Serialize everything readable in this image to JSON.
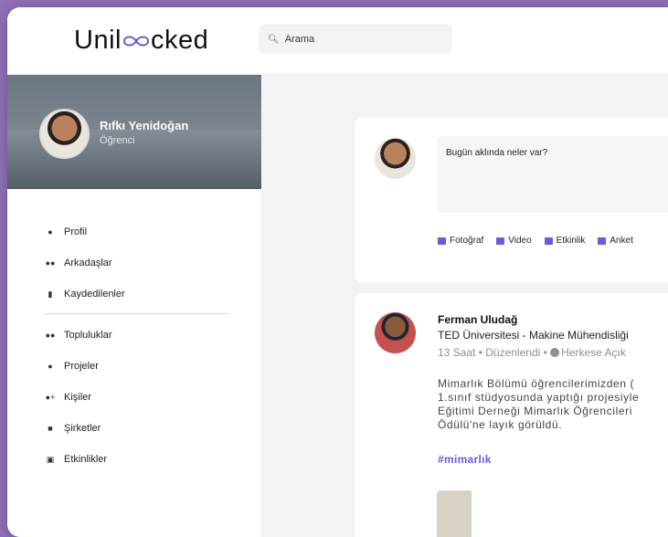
{
  "logo": {
    "text_pre": "Unil",
    "text_post": "cked"
  },
  "search": {
    "placeholder": "Arama"
  },
  "profile": {
    "name": "Rıfkı Yenidoğan",
    "role": "Öğrenci"
  },
  "nav": {
    "group1": [
      {
        "label": "Profil",
        "icon": "person-icon"
      },
      {
        "label": "Arkadaşlar",
        "icon": "friends-icon"
      },
      {
        "label": "Kaydedilenler",
        "icon": "bookmark-icon"
      }
    ],
    "group2": [
      {
        "label": "Topluluklar",
        "icon": "groups-icon"
      },
      {
        "label": "Projeler",
        "icon": "lightbulb-icon"
      },
      {
        "label": "Kişiler",
        "icon": "person-add-icon"
      },
      {
        "label": "Şirketler",
        "icon": "briefcase-icon"
      },
      {
        "label": "Etkinlikler",
        "icon": "calendar-icon"
      }
    ]
  },
  "composer": {
    "placeholder": "Bugün aklında neler var?",
    "actions": [
      {
        "label": "Fotoğraf",
        "icon": "photo-icon"
      },
      {
        "label": "Video",
        "icon": "video-icon"
      },
      {
        "label": "Etkinlik",
        "icon": "calendar-icon"
      },
      {
        "label": "Anket",
        "icon": "poll-icon"
      }
    ]
  },
  "post": {
    "author": "Ferman Uludağ",
    "organization": "TED Üniversitesi - Makine Mühendisliği",
    "time": "13 Saat",
    "edited": "Düzenlendi",
    "visibility": "Herkese Açık",
    "lines": [
      "Mimarlık Bölümü öğrencilerimizden (",
      "1.sınıf stüdyosunda yaptığı projesiyle",
      "Eğitimi Derneği Mimarlık Öğrencileri",
      "Ödülü'ne layık görüldü."
    ],
    "hashtag": "#mimarlık"
  },
  "colors": {
    "accent": "#6b5bd6",
    "frame": "#8f6fb8"
  }
}
